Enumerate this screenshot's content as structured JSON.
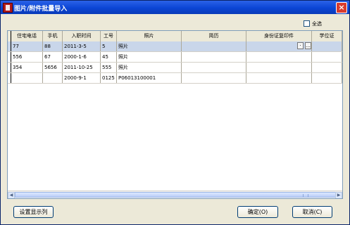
{
  "window": {
    "title": "图片/附件批量导入",
    "close_label": "×"
  },
  "options": {
    "select_all_label": "全选"
  },
  "table": {
    "headers": [
      "住宅电话",
      "手机",
      "入职时间",
      "工号",
      "照片",
      "简历",
      "身份证复印件",
      "学位证"
    ],
    "rows": [
      [
        "77",
        "88",
        "2011-3-5",
        "5",
        "照片",
        "",
        "",
        ""
      ],
      [
        "556",
        "67",
        "2000-1-6",
        "45",
        "照片",
        "",
        "",
        ""
      ],
      [
        "354",
        "5656",
        "2011-10-25",
        "555",
        "照片",
        "",
        "",
        ""
      ],
      [
        "",
        "",
        "2000-9-1",
        "0125",
        "P06013100001",
        "",
        "",
        ""
      ]
    ]
  },
  "cell_edit": {
    "dot_label": "·",
    "browse_label": "..."
  },
  "buttons": {
    "settings": "设置显示列",
    "ok": "确定(O)",
    "cancel": "取消(C)"
  }
}
